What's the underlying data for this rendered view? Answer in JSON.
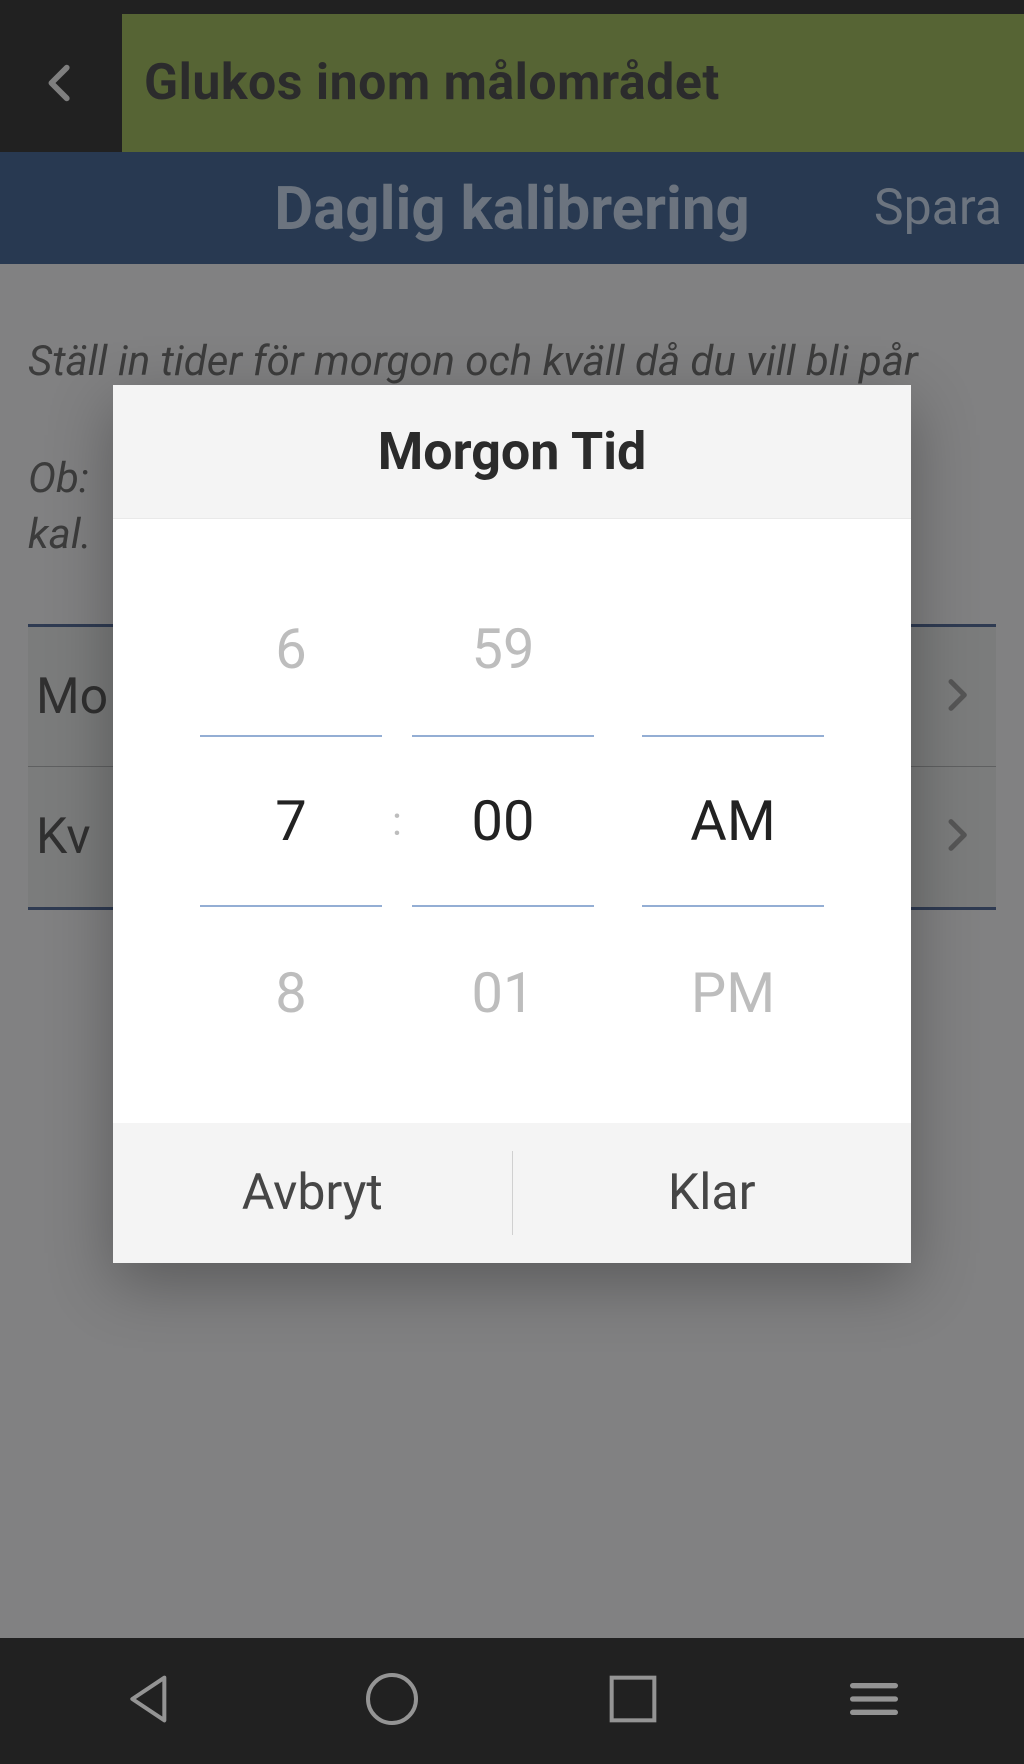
{
  "header": {
    "title": "Glukos inom målområdet"
  },
  "subheader": {
    "title": "Daglig kalibrering",
    "action": "Spara"
  },
  "page": {
    "description_line": "Ställ in tider för morgon och kväll då du vill bli pår",
    "obs_line": "Ob:",
    "kal_line": "kal.",
    "rows": [
      {
        "label": "Mo"
      },
      {
        "label": "Kv"
      }
    ]
  },
  "dialog": {
    "title": "Morgon Tid",
    "hour_prev": "6",
    "hour_current": "7",
    "hour_next": "8",
    "minute_prev": "59",
    "minute_current": "00",
    "minute_next": "01",
    "ampm_prev": "",
    "ampm_current": "AM",
    "ampm_next": "PM",
    "cancel": "Avbryt",
    "done": "Klar",
    "colon": ":"
  }
}
